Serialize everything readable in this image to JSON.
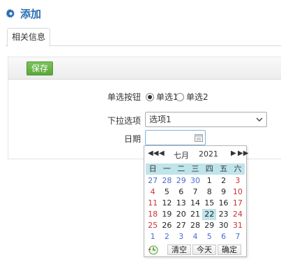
{
  "header": {
    "title": "添加",
    "icon": "gear-icon"
  },
  "tabs": [
    {
      "label": "相关信息"
    }
  ],
  "toolbar": {
    "save_label": "保存"
  },
  "form": {
    "radio_label": "单选按钮",
    "radio_options": [
      {
        "label": "单选1",
        "checked": true
      },
      {
        "label": "单选2",
        "checked": false
      }
    ],
    "select_label": "下拉选项",
    "select_value": "选项1",
    "date_label": "日期",
    "date_value": ""
  },
  "calendar": {
    "month": "七月",
    "year": "2021",
    "weekdays": [
      "日",
      "一",
      "二",
      "三",
      "四",
      "五",
      "六"
    ],
    "days": [
      [
        "27",
        "28",
        "29",
        "30",
        "1",
        "2",
        "3"
      ],
      [
        "4",
        "5",
        "6",
        "7",
        "8",
        "9",
        "10"
      ],
      [
        "11",
        "12",
        "13",
        "14",
        "15",
        "16",
        "17"
      ],
      [
        "18",
        "19",
        "20",
        "21",
        "22",
        "23",
        "24"
      ],
      [
        "25",
        "26",
        "27",
        "28",
        "29",
        "30",
        "31"
      ],
      [
        "1",
        "2",
        "3",
        "4",
        "5",
        "6",
        "7"
      ]
    ],
    "selected_day": "22",
    "buttons": {
      "clear": "清空",
      "today": "今天",
      "ok": "确定"
    }
  }
}
